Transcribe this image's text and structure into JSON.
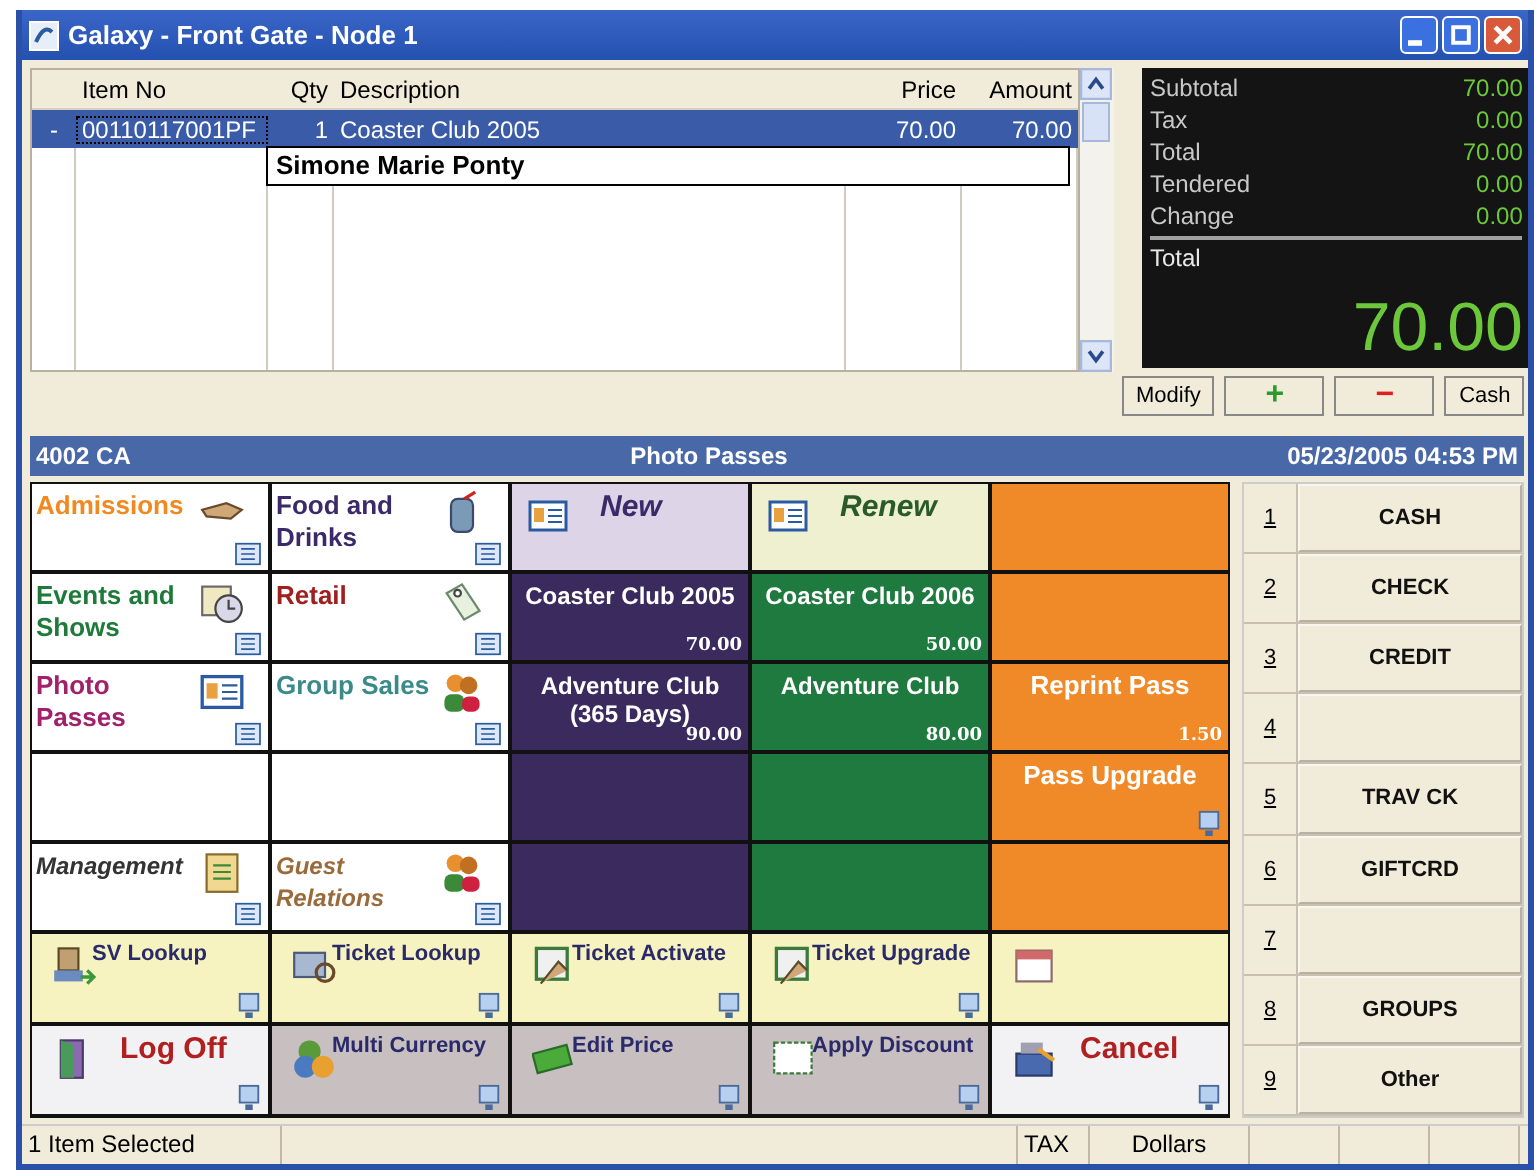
{
  "window": {
    "title": "Galaxy - Front Gate - Node 1"
  },
  "items_table": {
    "columns": [
      {
        "label": "Item No"
      },
      {
        "label": "Qty"
      },
      {
        "label": "Description"
      },
      {
        "label": "Price"
      },
      {
        "label": "Amount"
      }
    ],
    "rows": [
      {
        "marker": "-",
        "cells": [
          "00110117001PF",
          "1",
          "Coaster Club 2005",
          "70.00",
          "70.00"
        ],
        "selected": true
      }
    ],
    "name_tag": "Simone Marie Ponty"
  },
  "totals": {
    "lines": [
      {
        "label": "Subtotal",
        "value": "70.00"
      },
      {
        "label": "Tax",
        "value": "0.00"
      },
      {
        "label": "Total",
        "value": "70.00"
      },
      {
        "label": "Tendered",
        "value": "0.00"
      },
      {
        "label": "Change",
        "value": "0.00"
      }
    ],
    "total_label": "Total",
    "total_value": "70.00"
  },
  "line_actions": [
    {
      "kind": "text",
      "label": "Modify"
    },
    {
      "kind": "add",
      "label": "+"
    },
    {
      "kind": "remove",
      "label": "−"
    },
    {
      "kind": "text",
      "label": "Cash"
    }
  ],
  "header": {
    "location": "4002 CA",
    "section": "Photo Passes",
    "datetime": "05/23/2005  04:53 PM"
  },
  "categories": [
    {
      "kind": "category",
      "label": "Admissions",
      "color": "#f08a20"
    },
    {
      "kind": "category",
      "label": "Food and Drinks",
      "color": "#3a2a6a"
    },
    {
      "kind": "category",
      "label": "Events and Shows",
      "color": "#1f7a3a"
    },
    {
      "kind": "category",
      "label": "Retail",
      "color": "#a02020"
    },
    {
      "kind": "category",
      "label": "Photo Passes",
      "color": "#a0206a"
    },
    {
      "kind": "category",
      "label": "Group Sales",
      "color": "#3a8a8a"
    },
    {
      "kind": "empty"
    },
    {
      "kind": "empty"
    },
    {
      "kind": "admin",
      "label": "Management",
      "color": "#333333"
    },
    {
      "kind": "admin",
      "label": "Guest Relations",
      "color": "#9a6a3a"
    }
  ],
  "products": [
    {
      "kind": "header",
      "label": "New",
      "color": "#ddd4e8"
    },
    {
      "kind": "header",
      "label": "Renew",
      "color": "#eef0d0"
    },
    {
      "kind": "blank",
      "color": "#f08a28"
    },
    {
      "kind": "product",
      "label": "Coaster Club 2005",
      "price": "70.00",
      "color": "#3a2a5e"
    },
    {
      "kind": "product",
      "label": "Coaster Club 2006",
      "price": "50.00",
      "color": "#1e7a3e"
    },
    {
      "kind": "blank",
      "color": "#f08a28"
    },
    {
      "kind": "product",
      "label": "Adventure Club (365 Days)",
      "price": "90.00",
      "color": "#3a2a5e"
    },
    {
      "kind": "product",
      "label": "Adventure Club",
      "price": "80.00",
      "color": "#1e7a3e"
    },
    {
      "kind": "product",
      "label": "Reprint Pass",
      "price": "1.50",
      "color": "#f08a28"
    },
    {
      "kind": "blank",
      "color": "#3a2a5e"
    },
    {
      "kind": "blank",
      "color": "#1e7a3e"
    },
    {
      "kind": "action",
      "label": "Pass Upgrade",
      "color": "#f08a28"
    },
    {
      "kind": "blank",
      "color": "#3a2a5e"
    },
    {
      "kind": "blank",
      "color": "#1e7a3e"
    },
    {
      "kind": "blank",
      "color": "#f08a28"
    }
  ],
  "functions": [
    {
      "kind": "tool",
      "label": "SV Lookup"
    },
    {
      "kind": "tool",
      "label": "Ticket Lookup"
    },
    {
      "kind": "tool",
      "label": "Ticket Activate"
    },
    {
      "kind": "tool",
      "label": "Ticket Upgrade"
    },
    {
      "kind": "tool"
    },
    {
      "kind": "exit",
      "label": "Log Off"
    },
    {
      "kind": "option",
      "label": "Multi Currency"
    },
    {
      "kind": "option",
      "label": "Edit Price"
    },
    {
      "kind": "option",
      "label": "Apply Discount"
    },
    {
      "kind": "exit",
      "label": "Cancel"
    }
  ],
  "tenders": [
    {
      "key": "1",
      "label": "CASH"
    },
    {
      "key": "2",
      "label": "CHECK"
    },
    {
      "key": "3",
      "label": "CREDIT"
    },
    {
      "key": "4"
    },
    {
      "key": "5",
      "label": "TRAV CK"
    },
    {
      "key": "6",
      "label": "GIFTCRD"
    },
    {
      "key": "7"
    },
    {
      "key": "8",
      "label": "GROUPS"
    },
    {
      "key": "9",
      "label": "Other"
    }
  ],
  "status_bar": {
    "message": "1 Item Selected",
    "tax": "TAX",
    "currency": "Dollars"
  }
}
